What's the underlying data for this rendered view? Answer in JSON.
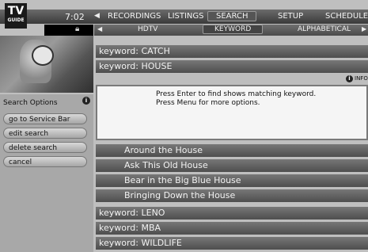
{
  "header": {
    "logo": {
      "top": "TV",
      "bottom": "GUIDE"
    },
    "time": "7:02",
    "nav": [
      "RECORDINGS",
      "LISTINGS",
      "SEARCH",
      "SETUP",
      "SCHEDULE"
    ],
    "selected_nav": "SEARCH"
  },
  "subtabs": {
    "items": [
      "HDTV",
      "KEYWORD",
      "ALPHABETICAL"
    ],
    "selected": "KEYWORD"
  },
  "search_options": {
    "title": "Search Options",
    "buttons": [
      "go to Service Bar",
      "edit search",
      "delete search",
      "cancel"
    ]
  },
  "keywords_top": [
    "keyword: CATCH",
    "keyword: HOUSE"
  ],
  "info_label": "INFO",
  "message": {
    "line1": "Press Enter to find shows matching keyword.",
    "line2": "Press Menu for more options."
  },
  "results": [
    "Around the House",
    "Ask This Old House",
    "Bear in the Big Blue House",
    "Bringing Down the House"
  ],
  "keywords_bottom": [
    "keyword: LENO",
    "keyword: MBA",
    "keyword: WILDLIFE"
  ],
  "colors": {
    "bar_dark": "#4e4e4e",
    "bar_light": "#777777",
    "panel": "#a8a8a8",
    "message_bg": "#f5f5f5"
  }
}
